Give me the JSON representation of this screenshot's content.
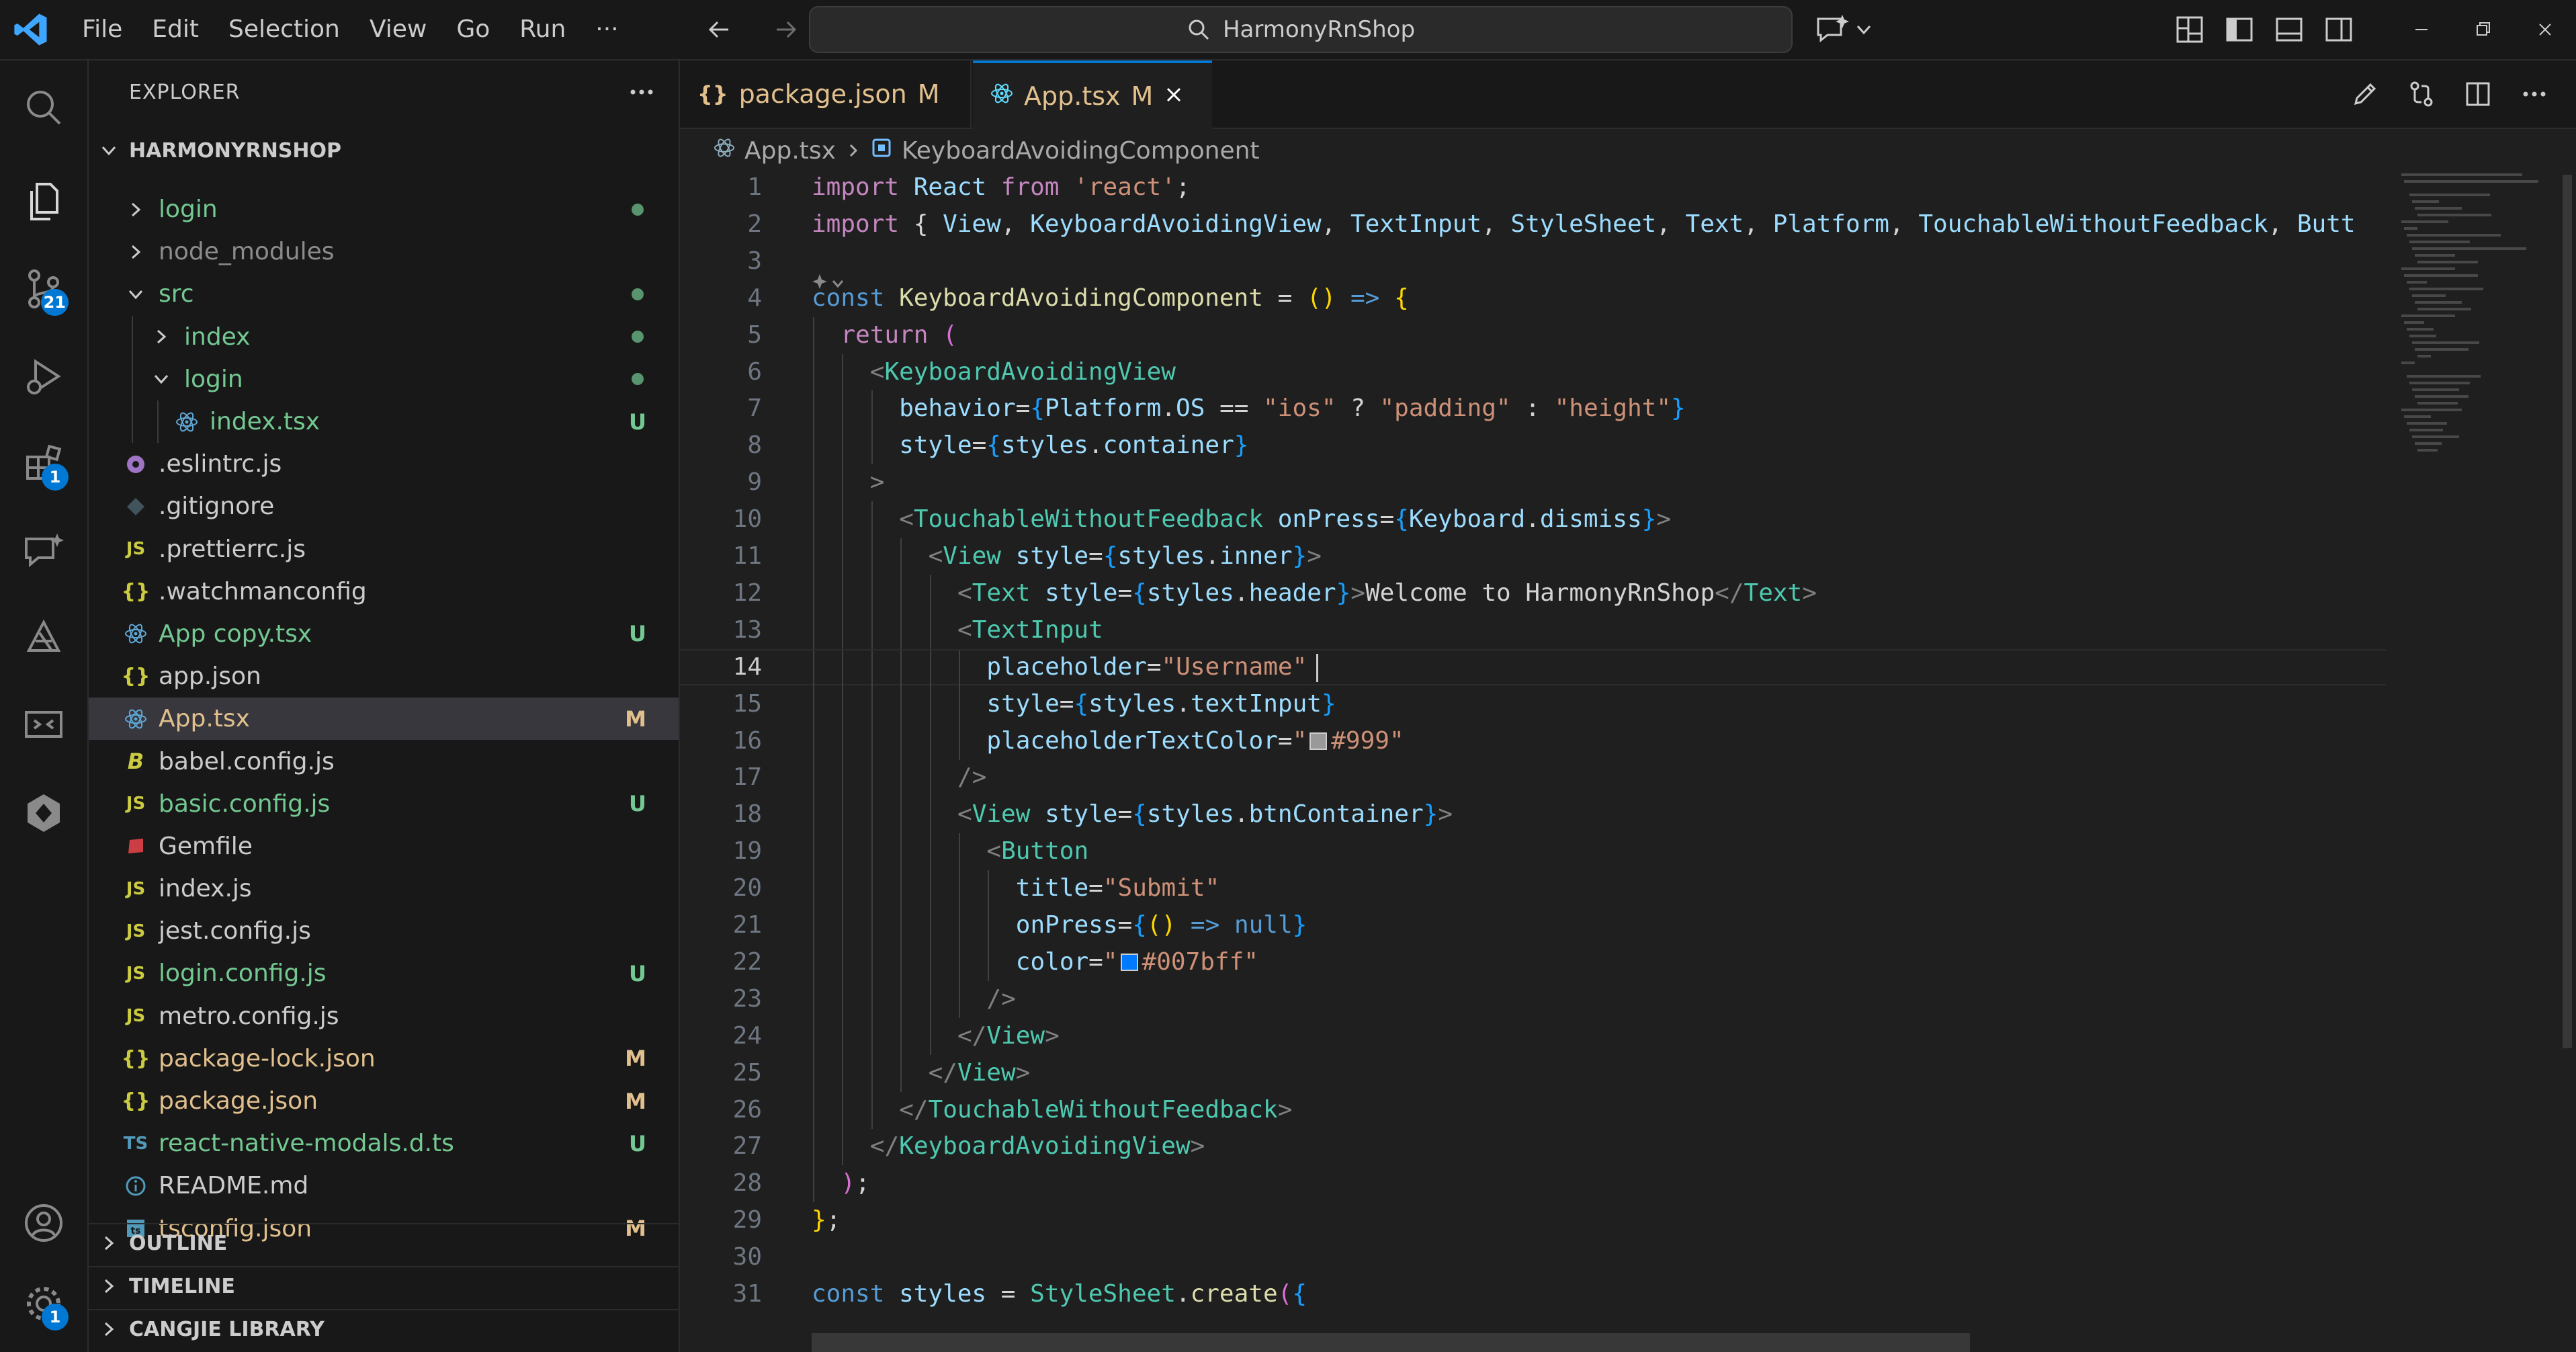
{
  "menu": [
    "File",
    "Edit",
    "Selection",
    "View",
    "Go",
    "Run",
    "···"
  ],
  "search": {
    "label": "HarmonyRnShop"
  },
  "sidebar": {
    "title": "EXPLORER",
    "root": "HARMONYRNSHOP",
    "items": [
      {
        "label": "login",
        "kind": "folder",
        "status": "dot"
      },
      {
        "label": "node_modules",
        "kind": "folder",
        "status": ""
      },
      {
        "label": "src",
        "kind": "folder-open",
        "status": "dot"
      },
      {
        "label": "index",
        "kind": "folder",
        "status": "dot"
      },
      {
        "label": "login",
        "kind": "folder-open",
        "status": "dot"
      },
      {
        "label": "index.tsx",
        "kind": "react",
        "status": "U"
      },
      {
        "label": ".eslintrc.js",
        "kind": "eslint",
        "status": ""
      },
      {
        "label": ".gitignore",
        "kind": "git",
        "status": ""
      },
      {
        "label": ".prettierrc.js",
        "kind": "js",
        "status": ""
      },
      {
        "label": ".watchmanconfig",
        "kind": "json",
        "status": ""
      },
      {
        "label": "App copy.tsx",
        "kind": "react",
        "status": "U"
      },
      {
        "label": "app.json",
        "kind": "json",
        "status": ""
      },
      {
        "label": "App.tsx",
        "kind": "react",
        "status": "M"
      },
      {
        "label": "babel.config.js",
        "kind": "babel",
        "status": ""
      },
      {
        "label": "basic.config.js",
        "kind": "js",
        "status": "U"
      },
      {
        "label": "Gemfile",
        "kind": "ruby",
        "status": ""
      },
      {
        "label": "index.js",
        "kind": "js",
        "status": ""
      },
      {
        "label": "jest.config.js",
        "kind": "js",
        "status": ""
      },
      {
        "label": "login.config.js",
        "kind": "js",
        "status": "U"
      },
      {
        "label": "metro.config.js",
        "kind": "js",
        "status": ""
      },
      {
        "label": "package-lock.json",
        "kind": "json",
        "status": "M"
      },
      {
        "label": "package.json",
        "kind": "json",
        "status": "M"
      },
      {
        "label": "react-native-modals.d.ts",
        "kind": "ts",
        "status": "U"
      },
      {
        "label": "README.md",
        "kind": "info",
        "status": ""
      },
      {
        "label": "tsconfig.json",
        "kind": "tsconfig",
        "status": "M"
      }
    ],
    "sections": [
      "OUTLINE",
      "TIMELINE",
      "CANGJIE LIBRARY"
    ]
  },
  "activity": {
    "badges": {
      "scm": "21",
      "extensions": "1",
      "settings": "1"
    }
  },
  "tabs": [
    {
      "label": "package.json",
      "status": "M"
    },
    {
      "label": "App.tsx",
      "status": "M"
    }
  ],
  "breadcrumb": [
    "App.tsx",
    "KeyboardAvoidingComponent"
  ],
  "line_numbers": [
    "1",
    "2",
    "3",
    "4",
    "5",
    "6",
    "7",
    "8",
    "9",
    "10",
    "11",
    "12",
    "13",
    "14",
    "15",
    "16",
    "17",
    "18",
    "19",
    "20",
    "21",
    "22",
    "23",
    "24",
    "25",
    "26",
    "27",
    "28",
    "29",
    "30",
    "31"
  ],
  "current_line": "14",
  "code": {
    "l1": [
      "import",
      " React ",
      "from",
      " ",
      "'react'",
      ";"
    ],
    "l2": [
      "import",
      " { ",
      "View",
      ", ",
      "KeyboardAvoidingView",
      ", ",
      "TextInput",
      ", ",
      "StyleSheet",
      ", ",
      "Text",
      ", ",
      "Platform",
      ", ",
      "TouchableWithoutFeedback",
      ", ",
      "Butt"
    ],
    "l4": [
      "const",
      " ",
      "KeyboardAvoidingComponent",
      " = ",
      "()",
      " ",
      "=>",
      " ",
      "{"
    ],
    "l5": [
      "return",
      " ",
      "("
    ],
    "l6": [
      "<",
      "KeyboardAvoidingView"
    ],
    "l7": [
      "behavior",
      "=",
      "{",
      "Platform",
      ".",
      "OS",
      " == ",
      "\"ios\"",
      " ? ",
      "\"padding\"",
      " : ",
      "\"height\"",
      "}"
    ],
    "l8": [
      "style",
      "=",
      "{",
      "styles",
      ".",
      "container",
      "}"
    ],
    "l9": [
      ">"
    ],
    "l10": [
      "<",
      "TouchableWithoutFeedback",
      " ",
      "onPress",
      "=",
      "{",
      "Keyboard",
      ".",
      "dismiss",
      "}",
      ">"
    ],
    "l11": [
      "<",
      "View",
      " ",
      "style",
      "=",
      "{",
      "styles",
      ".",
      "inner",
      "}",
      ">"
    ],
    "l12": [
      "<",
      "Text",
      " ",
      "style",
      "=",
      "{",
      "styles",
      ".",
      "header",
      "}",
      ">",
      "Welcome to HarmonyRnShop",
      "</",
      "Text",
      ">"
    ],
    "l13": [
      "<",
      "TextInput"
    ],
    "l14": [
      "placeholder",
      "=",
      "\"Username\""
    ],
    "l15": [
      "style",
      "=",
      "{",
      "styles",
      ".",
      "textInput",
      "}"
    ],
    "l16": [
      "placeholderTextColor",
      "=",
      "\"",
      "#999\""
    ],
    "l17": [
      "/>"
    ],
    "l18": [
      "<",
      "View",
      " ",
      "style",
      "=",
      "{",
      "styles",
      ".",
      "btnContainer",
      "}",
      ">"
    ],
    "l19": [
      "<",
      "Button"
    ],
    "l20": [
      "title",
      "=",
      "\"Submit\""
    ],
    "l21": [
      "onPress",
      "=",
      "{",
      "()",
      " => ",
      "null",
      "}"
    ],
    "l22": [
      "color",
      "=",
      "\"",
      "#007bff\""
    ],
    "l23": [
      "/>"
    ],
    "l24": [
      "</",
      "View",
      ">"
    ],
    "l25": [
      "</",
      "View",
      ">"
    ],
    "l26": [
      "</",
      "TouchableWithoutFeedback",
      ">"
    ],
    "l27": [
      "</",
      "KeyboardAvoidingView",
      ">"
    ],
    "l28": [
      ")",
      ";"
    ],
    "l29": [
      "}",
      ";"
    ],
    "l31": [
      "const",
      " ",
      "styles",
      " = ",
      "StyleSheet",
      ".",
      "create",
      "(",
      "{"
    ]
  },
  "colors": {
    "accent": "#0078d4",
    "swatch_999": "#999999",
    "swatch_007bff": "#007bff"
  }
}
